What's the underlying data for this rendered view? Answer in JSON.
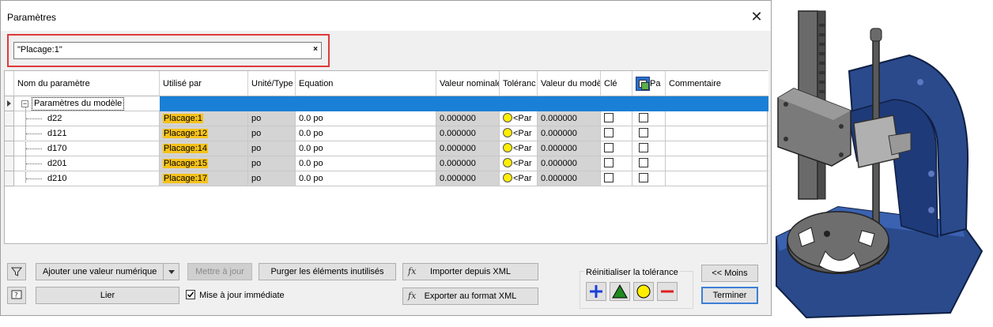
{
  "window": {
    "title": "Paramètres",
    "close_glyph": "✕"
  },
  "filter": {
    "value": "\"Placage:1\"",
    "clear_glyph": "×"
  },
  "grid": {
    "headers": {
      "name": "Nom du paramètre",
      "used_by": "Utilisé par",
      "unit": "Unité/Type",
      "equation": "Equation",
      "nominal": "Valeur nominale",
      "tolerance": "Toléranc",
      "model_value": "Valeur du modè",
      "key": "Clé",
      "export": "Pa",
      "comment": "Commentaire"
    },
    "group": {
      "label": "Paramètres du modèle",
      "expander": "−"
    },
    "rows": [
      {
        "name": "d22",
        "used_by": "Placage:1",
        "unit": "po",
        "equation": "0.0 po",
        "nominal": "0.000000",
        "tolerance": "<Par",
        "model_value": "0.000000"
      },
      {
        "name": "d121",
        "used_by": "Placage:12",
        "unit": "po",
        "equation": "0.0 po",
        "nominal": "0.000000",
        "tolerance": "<Par",
        "model_value": "0.000000"
      },
      {
        "name": "d170",
        "used_by": "Placage:14",
        "unit": "po",
        "equation": "0.0 po",
        "nominal": "0.000000",
        "tolerance": "<Par",
        "model_value": "0.000000"
      },
      {
        "name": "d201",
        "used_by": "Placage:15",
        "unit": "po",
        "equation": "0.0 po",
        "nominal": "0.000000",
        "tolerance": "<Par",
        "model_value": "0.000000"
      },
      {
        "name": "d210",
        "used_by": "Placage:17",
        "unit": "po",
        "equation": "0.0 po",
        "nominal": "0.000000",
        "tolerance": "<Par",
        "model_value": "0.000000"
      }
    ]
  },
  "toolbar": {
    "add_numeric": "Ajouter une valeur numérique",
    "update": "Mettre à jour",
    "purge": "Purger les éléments inutilisés",
    "import_xml": "Importer depuis XML",
    "link": "Lier",
    "immediate_update": "Mise à jour immédiate",
    "export_xml": "Exporter au format XML",
    "fx_glyph": "fx"
  },
  "tolerance_reset": {
    "label": "Réinitialiser la tolérance",
    "colors": {
      "plus": "#1a3fd6",
      "triangle": "#1f8a1f",
      "circle": "#ffee00",
      "minus": "#e02020"
    }
  },
  "buttons": {
    "less": "<< Moins",
    "finish": "Terminer"
  },
  "icons": {
    "filter": "filter-icon",
    "help": "help-icon",
    "dropdown": "chevron-down-icon",
    "export_param": "export-parameter-icon"
  },
  "colors": {
    "selection_blue": "#1a7fd6",
    "highlight_orange": "#f6c21a",
    "gray_cell": "#d4d4d4",
    "part_blue": "#2a4a8c"
  }
}
